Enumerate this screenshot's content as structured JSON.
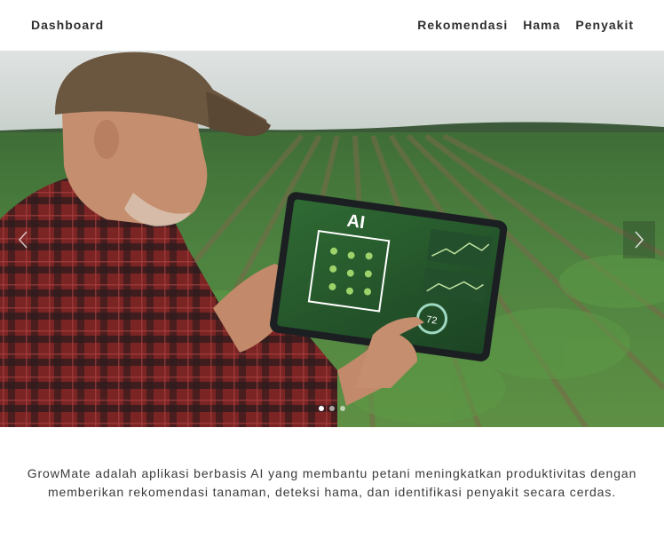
{
  "navbar": {
    "brand": "Dashboard",
    "links": [
      {
        "label": "Rekomendasi"
      },
      {
        "label": "Hama"
      },
      {
        "label": "Penyakit"
      }
    ]
  },
  "carousel": {
    "slide": {
      "tablet_text": "AI",
      "gauge_value": "72"
    },
    "prev_icon": "chevron-left-icon",
    "next_icon": "chevron-right-icon",
    "slide_count": 3,
    "active_index": 0
  },
  "description": "GrowMate adalah aplikasi berbasis AI yang membantu petani meningkatkan produktivitas dengan memberikan rekomendasi tanaman, deteksi hama, dan identifikasi penyakit secara cerdas.",
  "colors": {
    "text": "#2f2f2f",
    "field_green": "#4e7f3a",
    "shirt_red": "#8c2a2a"
  }
}
